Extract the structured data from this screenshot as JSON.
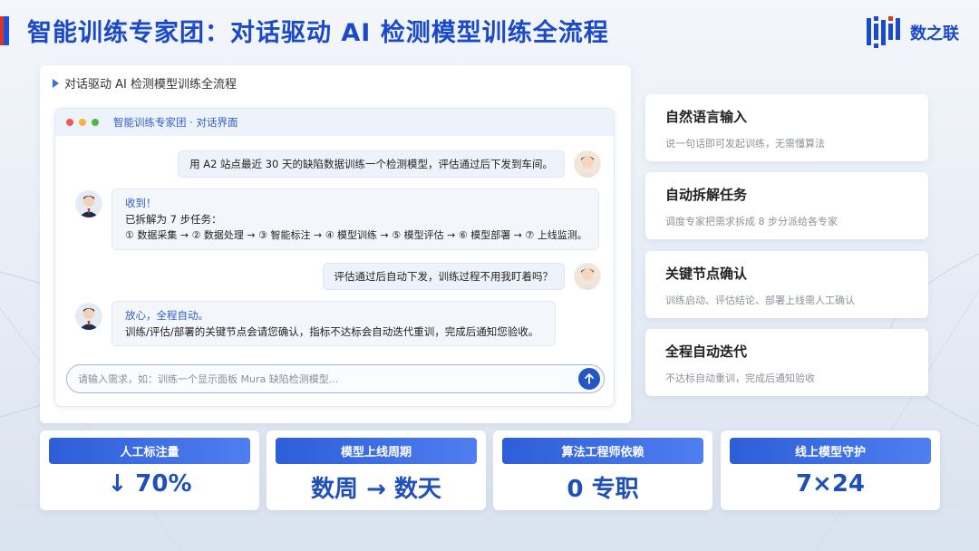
{
  "header": {
    "title": "智能训练专家团：对话驱动 AI 检测模型训练全流程",
    "logo_text": "数之联"
  },
  "chat_card": {
    "heading": "对话驱动 AI 检测模型训练全流程",
    "window_title": "智能训练专家团 · 对话界面",
    "messages": [
      {
        "role": "user",
        "text": "用 A2 站点最近 30 天的缺陷数据训练一个检测模型，评估通过后下发到车间。"
      },
      {
        "role": "bot",
        "title": "收到！",
        "line1": "已拆解为 7 步任务：",
        "line2": "① 数据采集 → ② 数据处理 → ③ 智能标注 → ④ 模型训练 → ⑤ 模型评估 → ⑥ 模型部署 → ⑦ 上线监测。"
      },
      {
        "role": "user",
        "text": "评估通过后自动下发，训练过程不用我盯着吗？"
      },
      {
        "role": "bot",
        "title": "放心，全程自动。",
        "line1": "训练/评估/部署的关键节点会请您确认，指标不达标会自动迭代重训，完成后通知您验收。"
      }
    ],
    "input_placeholder": "请输入需求，如：训练一个显示面板 Mura 缺陷检测模型..."
  },
  "features": [
    {
      "title": "自然语言输入",
      "desc": "说一句话即可发起训练，无需懂算法"
    },
    {
      "title": "自动拆解任务",
      "desc": "调度专家把需求拆成 8 步分派给各专家"
    },
    {
      "title": "关键节点确认",
      "desc": "训练启动、评估结论、部署上线需人工确认"
    },
    {
      "title": "全程自动迭代",
      "desc": "不达标自动重训，完成后通知验收"
    }
  ],
  "metrics": [
    {
      "label": "人工标注量",
      "value": "↓ 70%"
    },
    {
      "label": "模型上线周期",
      "value": "数周 → 数天"
    },
    {
      "label": "算法工程师依赖",
      "value": "0 专职"
    },
    {
      "label": "线上模型守护",
      "value": "7×24"
    }
  ],
  "colors": {
    "brand_blue": "#1a49c9",
    "accent_red": "#d9362b",
    "window_dot_red": "#ee5a52",
    "window_dot_yellow": "#f4b43c",
    "window_dot_green": "#4cb848"
  }
}
